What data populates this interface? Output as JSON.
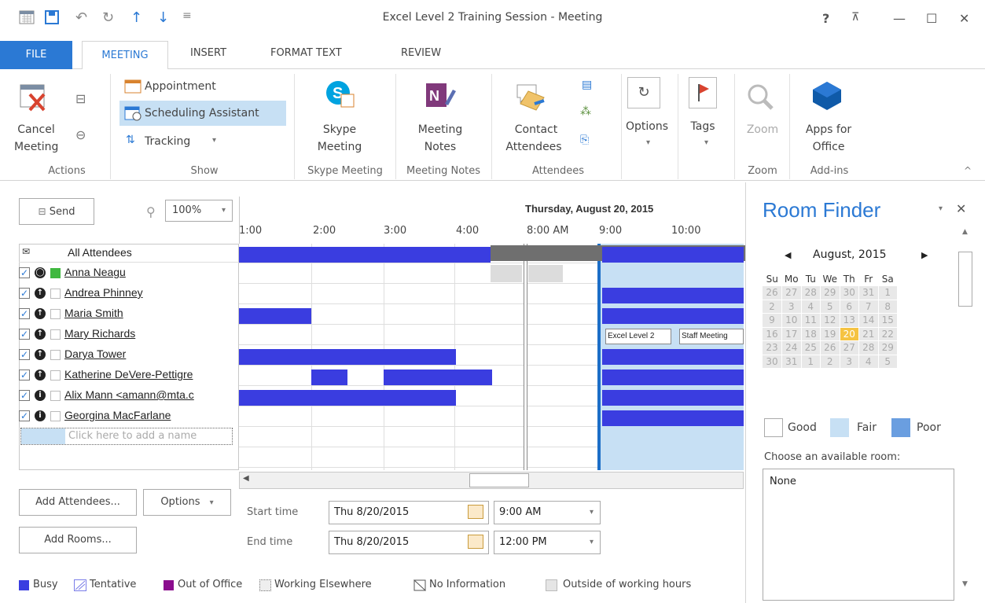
{
  "window": {
    "title": "Excel Level 2 Training Session - Meeting",
    "help": "?",
    "ribbon_display": "⊼",
    "minimize": "—",
    "maximize": "☐",
    "close": "✕"
  },
  "tabs": [
    "FILE",
    "MEETING",
    "INSERT",
    "FORMAT TEXT",
    "REVIEW"
  ],
  "ribbon": {
    "actions": {
      "cancel_line1": "Cancel",
      "cancel_line2": "Meeting",
      "group": "Actions"
    },
    "show": {
      "appointment": "Appointment",
      "scheduling": "Scheduling Assistant",
      "tracking": "Tracking",
      "group": "Show"
    },
    "skype": {
      "line1": "Skype",
      "line2": "Meeting",
      "group": "Skype Meeting"
    },
    "notes": {
      "line1": "Meeting",
      "line2": "Notes",
      "group": "Meeting Notes"
    },
    "attendees": {
      "line1": "Contact",
      "line2": "Attendees",
      "group": "Attendees"
    },
    "options": {
      "label": "Options"
    },
    "tags": {
      "label": "Tags"
    },
    "zoom": {
      "label": "Zoom",
      "group": "Zoom"
    },
    "apps": {
      "line1": "Apps for",
      "line2": "Office",
      "group": "Add-ins"
    }
  },
  "toolbar": {
    "send": "Send",
    "zoom": "100%"
  },
  "timeline": {
    "date": "Thursday, August 20, 2015",
    "left_times": [
      "1:00",
      "2:00",
      "3:00",
      "4:00"
    ],
    "right_times": [
      "8:00 AM",
      "9:00",
      "10:00"
    ]
  },
  "attendees": {
    "header": "All Attendees",
    "rows": [
      {
        "name": "Anna Neagu"
      },
      {
        "name": "Andrea Phinney"
      },
      {
        "name": "Maria Smith"
      },
      {
        "name": "Mary Richards"
      },
      {
        "name": "Darya Tower"
      },
      {
        "name": "Katherine DeVere-Pettigre"
      },
      {
        "name": "Alix Mann <amann@mta.c"
      },
      {
        "name": "Georgina MacFarlane"
      }
    ],
    "add_placeholder": "Click here to add a name"
  },
  "events": {
    "excel": "Excel Level 2",
    "staff": "Staff Meeting"
  },
  "bottom": {
    "add_attendees": "Add Attendees...",
    "options": "Options",
    "add_rooms": "Add Rooms...",
    "start_label": "Start time",
    "end_label": "End time",
    "start_date": "Thu 8/20/2015",
    "end_date": "Thu 8/20/2015",
    "start_time": "9:00 AM",
    "end_time": "12:00 PM"
  },
  "legend": [
    "Busy",
    "Tentative",
    "Out of Office",
    "Working Elsewhere",
    "No Information",
    "Outside of working hours"
  ],
  "room_finder": {
    "title": "Room Finder",
    "month": "August, 2015",
    "days": [
      "Su",
      "Mo",
      "Tu",
      "We",
      "Th",
      "Fr",
      "Sa"
    ],
    "weeks": [
      [
        "26",
        "27",
        "28",
        "29",
        "30",
        "31",
        "1"
      ],
      [
        "2",
        "3",
        "4",
        "5",
        "6",
        "7",
        "8"
      ],
      [
        "9",
        "10",
        "11",
        "12",
        "13",
        "14",
        "15"
      ],
      [
        "16",
        "17",
        "18",
        "19",
        "20",
        "21",
        "22"
      ],
      [
        "23",
        "24",
        "25",
        "26",
        "27",
        "28",
        "29"
      ],
      [
        "30",
        "31",
        "1",
        "2",
        "3",
        "4",
        "5"
      ]
    ],
    "good": "Good",
    "fair": "Fair",
    "poor": "Poor",
    "choose": "Choose an available room:",
    "room_none": "None"
  },
  "colors": {
    "busy": "#3a3de0",
    "accent": "#2b79d4",
    "fair": "#c7e0f4",
    "poor": "#6a9ee0",
    "today": "#f5c342"
  }
}
